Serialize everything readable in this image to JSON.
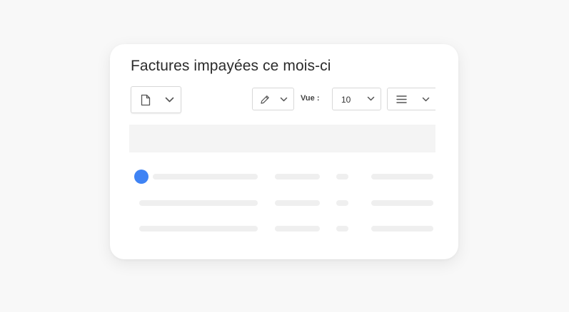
{
  "card": {
    "title": "Factures impayées ce mois-ci"
  },
  "toolbar": {
    "export_icon": "document-icon",
    "edit_icon": "pencil-icon",
    "view_label": "Vue :",
    "page_size_value": "10",
    "columns_icon": "menu-lines-icon"
  },
  "table": {
    "state": "loading",
    "placeholder_rows": 3
  },
  "colors": {
    "accent": "#3f83f4",
    "background": "#f8f8f8",
    "card": "#ffffff",
    "skeleton": "#efefef"
  }
}
